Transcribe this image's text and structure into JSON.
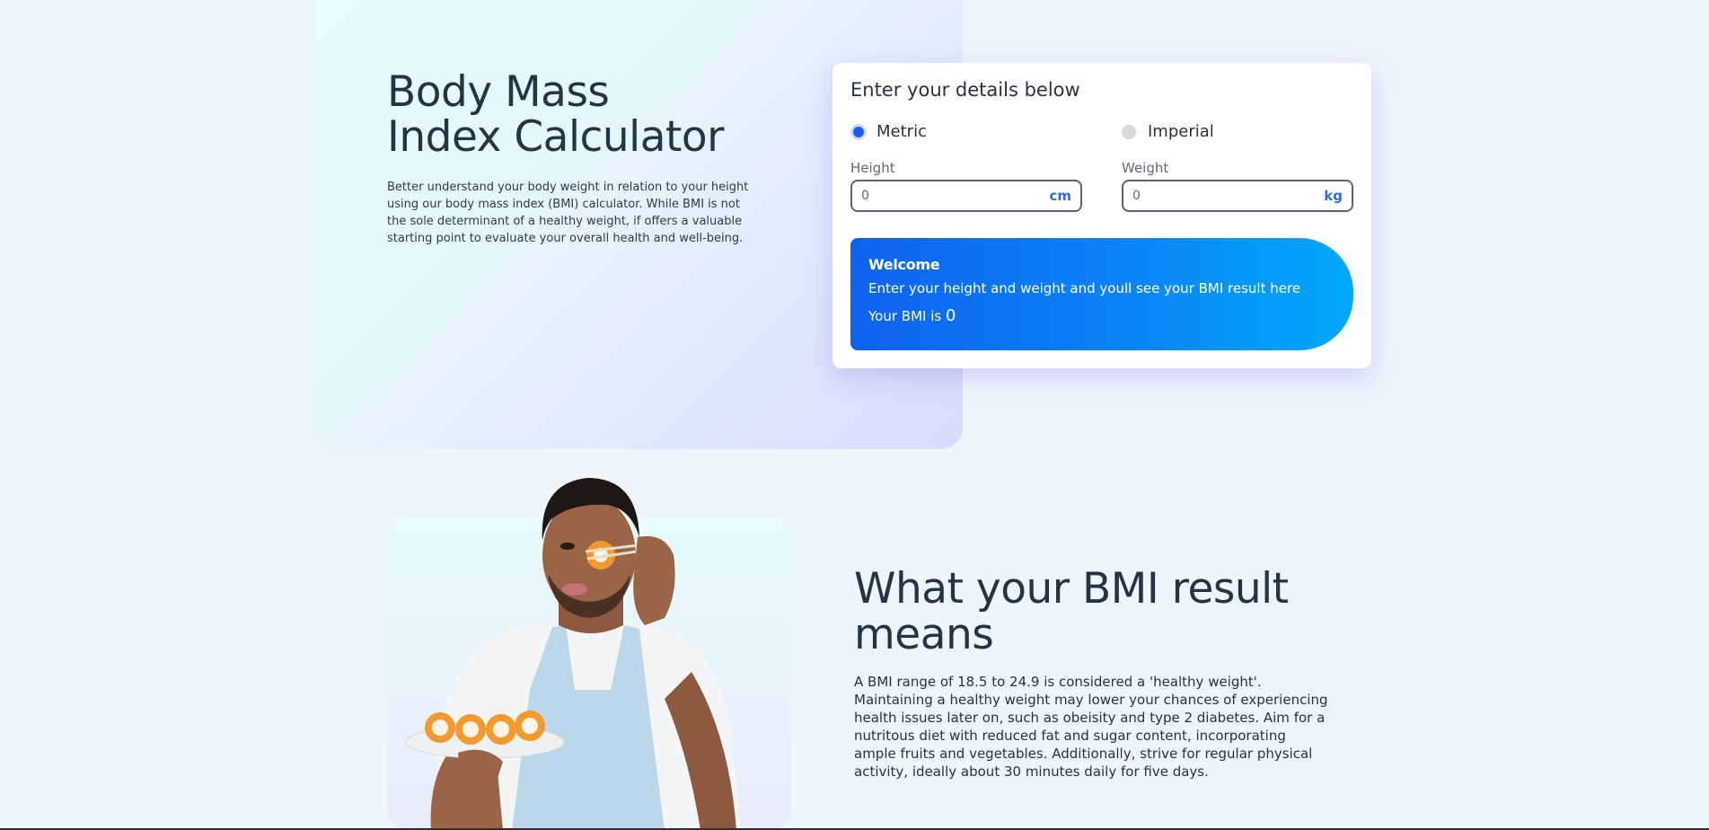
{
  "hero": {
    "title_line1": "Body Mass",
    "title_line2": "Index Calculator",
    "description": "Better understand your body weight in relation to your height using our body mass index (BMI) calculator. While BMI is not the sole determinant of a healthy weight, if offers a valuable starting point to evaluate your overall health and well-being."
  },
  "calculator": {
    "title": "Enter your details below",
    "units": {
      "metric_label": "Metric",
      "imperial_label": "Imperial",
      "selected": "Metric"
    },
    "height": {
      "label": "Height",
      "value": "0",
      "unit": "cm"
    },
    "weight": {
      "label": "Weight",
      "value": "0",
      "unit": "kg"
    },
    "result": {
      "title": "Welcome",
      "text": "Enter your height and weight and youll see your BMI result here",
      "bmi_prefix": "Your BMI is ",
      "bmi_value": "0"
    }
  },
  "meaning": {
    "title": "What your BMI result means",
    "description": "A BMI range of 18.5 to 24.9 is considered a 'healthy weight'. Maintaining a healthy weight may lower your chances of experiencing health issues later on, such as obeisity and type 2 diabetes. Aim for a nutritous diet with reduced fat and sugar content, incorporating ample fruits and vegetables. Additionally, strive for regular physical activity, ideally about 30 minutes daily for five days."
  },
  "colors": {
    "accent": "#1a5df5",
    "unit_text": "#2a6ed6",
    "heading": "#243447",
    "result_gradient_start": "#0e62ec",
    "result_gradient_end": "#02a8fc"
  }
}
